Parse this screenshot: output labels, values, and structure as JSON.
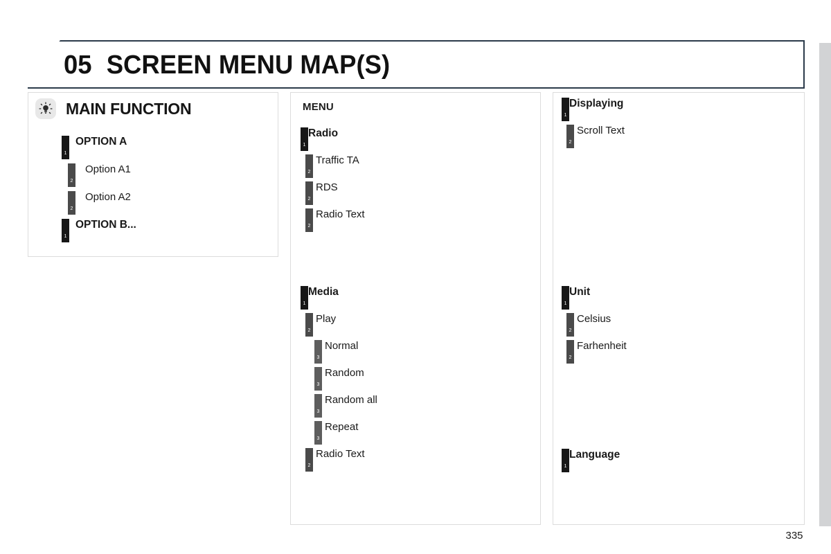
{
  "page": {
    "number": "335",
    "edge_tab_color": "#d2d3d5"
  },
  "banner": {
    "chapter_number": "05",
    "title": "SCREEN MENU MAP(S)",
    "border_color": "#2b3a4a"
  },
  "main_function_panel": {
    "icon": "light-bulb-icon",
    "title": "MAIN FUNCTION",
    "rows": [
      {
        "level": 1,
        "marker": "1",
        "label": "OPTION A"
      },
      {
        "level": 2,
        "marker": "2",
        "label": "Option A1"
      },
      {
        "level": 2,
        "marker": "2",
        "label": "Option A2"
      },
      {
        "level": 1,
        "marker": "1",
        "label": "OPTION B..."
      }
    ]
  },
  "menu_panel": {
    "caption": "MENU",
    "groups": [
      {
        "rows": [
          {
            "level": 1,
            "marker": "1",
            "label": "Radio"
          },
          {
            "level": 2,
            "marker": "2",
            "label": "Traffic TA"
          },
          {
            "level": 2,
            "marker": "2",
            "label": "RDS"
          },
          {
            "level": 2,
            "marker": "2",
            "label": "Radio Text"
          }
        ]
      },
      {
        "rows": [
          {
            "level": 1,
            "marker": "1",
            "label": "Media"
          },
          {
            "level": 2,
            "marker": "2",
            "label": "Play"
          },
          {
            "level": 3,
            "marker": "3",
            "label": "Normal"
          },
          {
            "level": 3,
            "marker": "3",
            "label": "Random"
          },
          {
            "level": 3,
            "marker": "3",
            "label": "Random all"
          },
          {
            "level": 3,
            "marker": "3",
            "label": "Repeat"
          },
          {
            "level": 2,
            "marker": "2",
            "label": "Radio Text"
          }
        ]
      }
    ]
  },
  "settings_panel": {
    "groups": [
      {
        "rows": [
          {
            "level": 1,
            "marker": "1",
            "label": "Displaying"
          },
          {
            "level": 2,
            "marker": "2",
            "label": "Scroll Text"
          }
        ]
      },
      {
        "rows": [
          {
            "level": 1,
            "marker": "1",
            "label": "Unit"
          },
          {
            "level": 2,
            "marker": "2",
            "label": "Celsius"
          },
          {
            "level": 2,
            "marker": "2",
            "label": "Farhenheit"
          }
        ]
      },
      {
        "rows": [
          {
            "level": 1,
            "marker": "1",
            "label": "Language"
          }
        ]
      }
    ]
  },
  "colors": {
    "level1_marker": "#171717",
    "level2_marker": "#4a4a4a",
    "level3_marker": "#5e5e5e",
    "panel_border": "#dcdcdc",
    "text": "#191919"
  }
}
